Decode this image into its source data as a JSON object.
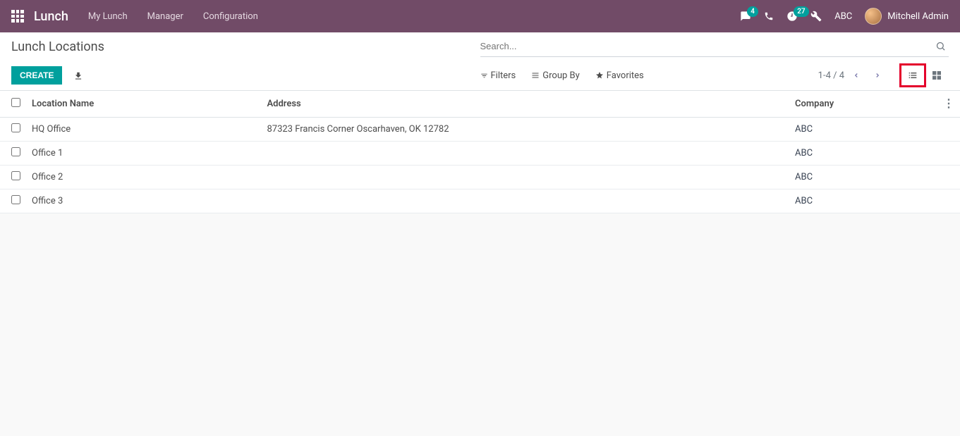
{
  "navbar": {
    "app_name": "Lunch",
    "menu": [
      "My Lunch",
      "Manager",
      "Configuration"
    ],
    "messages_badge": "4",
    "activities_badge": "27",
    "company": "ABC",
    "user_name": "Mitchell Admin"
  },
  "breadcrumb": "Lunch Locations",
  "buttons": {
    "create": "CREATE"
  },
  "search": {
    "placeholder": "Search...",
    "filters_label": "Filters",
    "groupby_label": "Group By",
    "favorites_label": "Favorites"
  },
  "pager": {
    "range": "1-4 / 4"
  },
  "table": {
    "headers": {
      "name": "Location Name",
      "address": "Address",
      "company": "Company"
    },
    "rows": [
      {
        "name": "HQ Office",
        "address": "87323 Francis Corner Oscarhaven, OK 12782",
        "company": "ABC"
      },
      {
        "name": "Office 1",
        "address": "",
        "company": "ABC"
      },
      {
        "name": "Office 2",
        "address": "",
        "company": "ABC"
      },
      {
        "name": "Office 3",
        "address": "",
        "company": "ABC"
      }
    ]
  }
}
